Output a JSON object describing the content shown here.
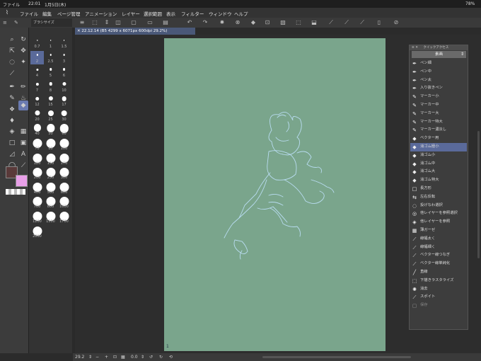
{
  "statusbar": {
    "app_label": "ファイル",
    "time": "22:01",
    "date": "1月5日(木)",
    "battery": "78%"
  },
  "menu": {
    "items": [
      "ファイル",
      "編集",
      "ページ管理",
      "アニメーション",
      "レイヤー",
      "選択範囲",
      "表示",
      "フィルター",
      "ウィンドウ",
      "ヘルプ"
    ]
  },
  "brush_panel": {
    "tab_label": "ブラシサイズ",
    "sizes": [
      "0.7",
      "1",
      "1.5",
      "2",
      "2.5",
      "3",
      "4",
      "5",
      "6",
      "7",
      "8",
      "10",
      "12",
      "15",
      "17",
      "20",
      "25",
      "30",
      "40",
      "50",
      "60",
      "70",
      "80",
      "100",
      "120",
      "150",
      "170",
      "200",
      "250",
      "300",
      "400",
      "500",
      "600",
      "700",
      "800",
      "1000",
      "1200",
      "1500",
      "1700",
      "2000"
    ]
  },
  "document": {
    "tab_title": "22.12.14 (B5 4299 x 6071px 600dpi 29.2%)"
  },
  "canvas": {
    "page_number": "1",
    "bg_color": "#7aa58c"
  },
  "bottom": {
    "zoom": "29.2",
    "rotate": "0.0"
  },
  "quick_access": {
    "header": "クイックアクセス",
    "selector": "素画",
    "items": [
      {
        "label": "ペン細",
        "icon": "pen-icon"
      },
      {
        "label": "ペン中",
        "icon": "pen-icon"
      },
      {
        "label": "ペン太",
        "icon": "pen-icon"
      },
      {
        "label": "入り抜きペン",
        "icon": "pen-icon"
      },
      {
        "label": "マーカー小",
        "icon": "marker-icon"
      },
      {
        "label": "マーカー中",
        "icon": "marker-icon"
      },
      {
        "label": "マーカー大",
        "icon": "marker-icon"
      },
      {
        "label": "マーカー特大",
        "icon": "marker-icon"
      },
      {
        "label": "マーカー濃淡し",
        "icon": "marker-icon"
      },
      {
        "label": "ベクター用",
        "icon": "eraser-icon"
      },
      {
        "label": "消ゴム極小",
        "icon": "eraser-icon"
      },
      {
        "label": "消ゴム小",
        "icon": "eraser-icon"
      },
      {
        "label": "消ゴム中",
        "icon": "eraser-icon"
      },
      {
        "label": "消ゴム大",
        "icon": "eraser-icon"
      },
      {
        "label": "消ゴム特大",
        "icon": "eraser-icon"
      },
      {
        "label": "長方形",
        "icon": "rectangle-icon"
      },
      {
        "label": "左右反転",
        "icon": "flip-icon"
      },
      {
        "label": "投げなわ選択",
        "icon": "lasso-icon"
      },
      {
        "label": "他レイヤーを参照選択",
        "icon": "reference-select-icon"
      },
      {
        "label": "他レイヤーを参照",
        "icon": "reference-icon"
      },
      {
        "label": "薄ガーゼ",
        "icon": "gauze-icon"
      },
      {
        "label": "線幅太く",
        "icon": "line-width-icon"
      },
      {
        "label": "線幅細く",
        "icon": "line-width-icon"
      },
      {
        "label": "ベクター線つなぎ",
        "icon": "vector-icon"
      },
      {
        "label": "ベクター線単純化",
        "icon": "vector-icon"
      },
      {
        "label": "直線",
        "icon": "line-icon"
      },
      {
        "label": "下描きラスタライズ",
        "icon": "rasterize-icon"
      },
      {
        "label": "消去",
        "icon": "clear-icon"
      },
      {
        "label": "スポイト",
        "icon": "eyedropper-icon"
      },
      {
        "label": "保存",
        "icon": "save-icon"
      }
    ],
    "selected_index": 10
  },
  "colors": {
    "main": "#5a3a3a",
    "sub": "#e8a0e8",
    "accent": "#5a6a9a"
  }
}
